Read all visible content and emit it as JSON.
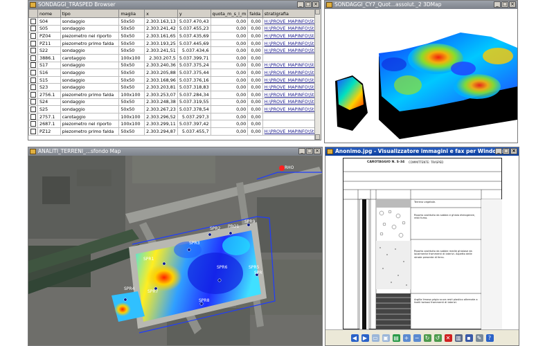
{
  "browser": {
    "title": "SONDAGGI_TRASPED Browser",
    "columns": [
      "nome",
      "tipo",
      "maglia",
      "x",
      "y",
      "quota_m_s_l_m",
      "falda",
      "stratigrafia"
    ],
    "rows": [
      [
        "S04",
        "sondaggio",
        "50x50",
        "2.303.163,13",
        "5.037.470,43",
        "0,00",
        "0,00",
        "H:\\PROVE_MAPINFO\\Stra"
      ],
      [
        "S05",
        "sondaggio",
        "50x50",
        "2.303.241,42",
        "5.037.455,23",
        "0,00",
        "0,00",
        "H:\\PROVE_MAPINFO\\Stra"
      ],
      [
        "PZ04",
        "piezometro nel riporto",
        "50x50",
        "2.303.161,65",
        "5.037.435,69",
        "0,00",
        "0,00",
        "H:\\PROVE_MAPINFO\\Stra"
      ],
      [
        "PZ11",
        "piezometro primo falda",
        "50x50",
        "2.303.193,25",
        "5.037.445,69",
        "0,00",
        "0,00",
        "H:\\PROVE_MAPINFO\\Stra"
      ],
      [
        "S22",
        "sondaggio",
        "50x50",
        "2.303.241,51",
        "5.037.434,6",
        "0,00",
        "0,00",
        "H:\\PROVE_MAPINFO\\Stra"
      ],
      [
        "3886.1",
        "carotaggio",
        "100x100",
        "2.303.207,5",
        "5.037.399,71",
        "0,00",
        "0,00",
        ""
      ],
      [
        "S17",
        "sondaggio",
        "50x50",
        "2.303.240,36",
        "5.037.375,24",
        "0,00",
        "0,00",
        "H:\\PROVE_MAPINFO\\Stra"
      ],
      [
        "S16",
        "sondaggio",
        "50x50",
        "2.303.205,88",
        "5.037.375,44",
        "0,00",
        "0,00",
        "H:\\PROVE_MAPINFO\\Stra"
      ],
      [
        "S15",
        "sondaggio",
        "50x50",
        "2.303.168,96",
        "5.037.376,16",
        "0,00",
        "0,00",
        "H:\\PROVE_MAPINFO\\Stra"
      ],
      [
        "S23",
        "sondaggio",
        "50x50",
        "2.303.203,81",
        "5.037.318,83",
        "0,00",
        "0,00",
        "H:\\PROVE_MAPINFO\\Stra"
      ],
      [
        "2756.1",
        "piezometro primo falda",
        "100x100",
        "2.303.253,07",
        "5.037.284,34",
        "0,00",
        "0,00",
        "H:\\PROVE_MAPINFO\\Stra"
      ],
      [
        "S24",
        "sondaggio",
        "50x50",
        "2.303.248,38",
        "5.037.319,55",
        "0,00",
        "0,00",
        "H:\\PROVE_MAPINFO\\Stra"
      ],
      [
        "S25",
        "sondaggio",
        "50x50",
        "2.303.267,23",
        "5.037.378,54",
        "0,00",
        "0,00",
        "H:\\PROVE_MAPINFO\\Stra"
      ],
      [
        "2757.1",
        "carotaggio",
        "100x100",
        "2.303.296,52",
        "5.037.297,3",
        "0,00",
        "0,00",
        ""
      ],
      [
        "2687.1",
        "piezometro nel riporto",
        "100x100",
        "2.303.299,11",
        "5.037.397,42",
        "0,00",
        "0,00",
        ""
      ],
      [
        "PZ12",
        "piezometro primo falda",
        "50x50",
        "2.303.294,87",
        "5.037.455,7",
        "0,00",
        "0,00",
        "H:\\PROVE_MAPINFO\\Stra"
      ]
    ]
  },
  "map3d": {
    "title": "SONDAGGI_CY7_Quot...assolut._2 3DMap"
  },
  "map2d": {
    "title": "ANALITI_TERRENI_...sfondo Map",
    "labels": [
      "SPR1",
      "SPR2",
      "SPR3",
      "SPR4",
      "SPR5",
      "SPR6",
      "SPR7",
      "SPR8",
      "SPR9",
      "PRO1",
      "SPR",
      "RHO"
    ]
  },
  "viewer": {
    "title": "Anonimo.jpg - Visualizzatore immagini e fax per Windows",
    "doc_code": "CAROTAGGIO N. S-34",
    "doc_client": "COMMITTENTE: TRASPED",
    "doc_desc1": "Terreno vegetale.",
    "doc_desc2": "Riporto costituito da sabbia e ghiaia eterogenee, resti fumo.",
    "doc_desc3": "Riporto costituito da sabbie medie ghiaiose da localmente frammenti di laterizi. Aspetto delle strade presente di ferro.",
    "doc_desc4": "Argilla limosa grigio scura resti plastico alternate a livelli torbosi frammenti di laterizi."
  },
  "colors": {
    "title_active": "#0a3d9c",
    "title_inactive": "#7d828b",
    "map_boundary": "#1e3cff",
    "point_marker": "#0a1a8c"
  }
}
